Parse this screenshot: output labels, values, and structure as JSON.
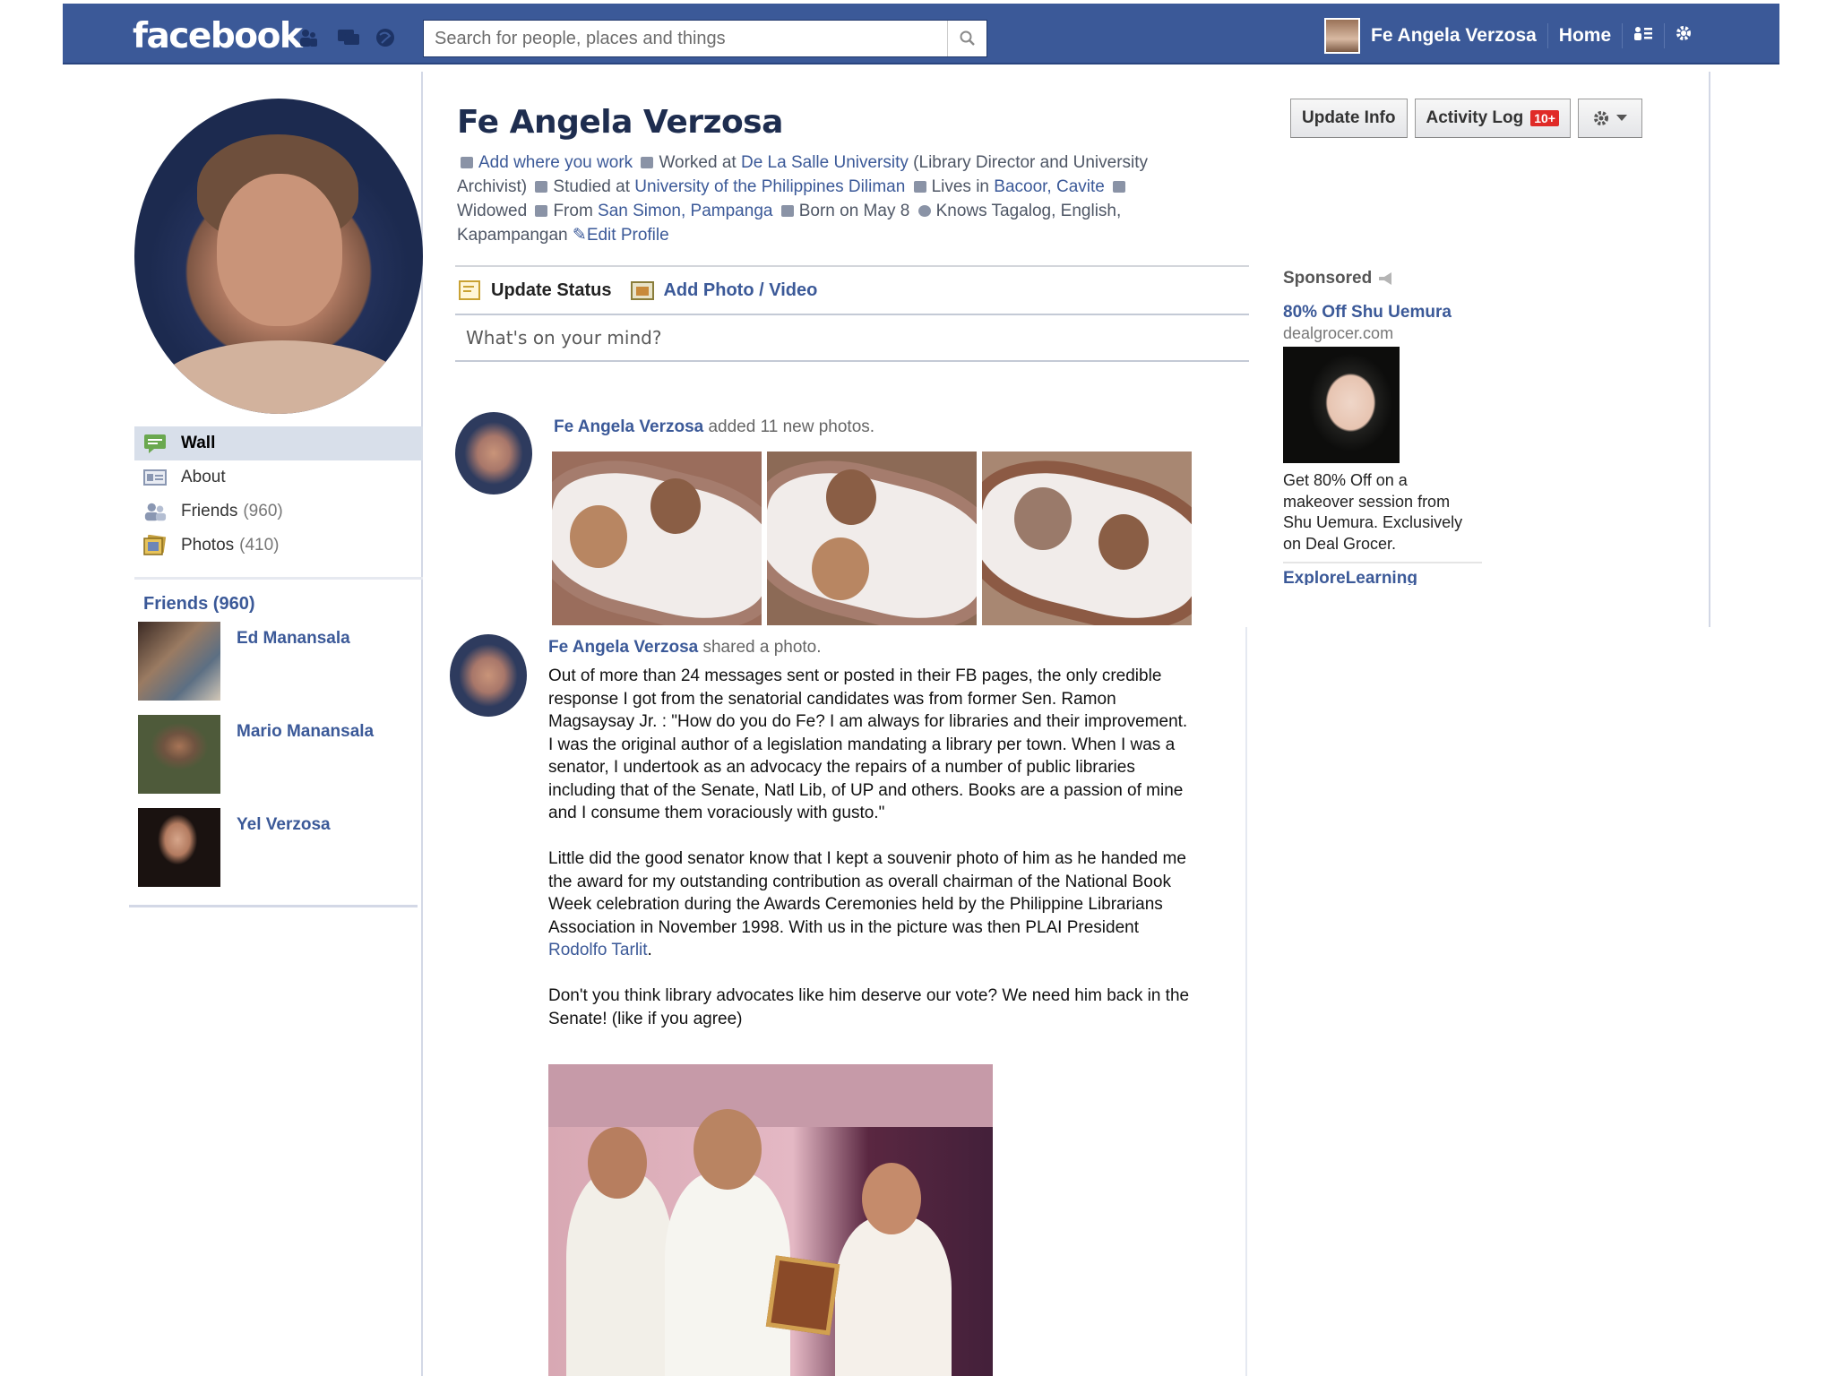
{
  "topbar": {
    "logo": "facebook",
    "search_placeholder": "Search for people, places and things",
    "user_name": "Fe Angela Verzosa",
    "home": "Home"
  },
  "profile": {
    "name": "Fe Angela Verzosa",
    "about": {
      "add_work": "Add where you work",
      "worked_prefix": "Worked at",
      "worked_at": "De La Salle University",
      "worked_role": "(Library Director and University Archivist)",
      "studied_prefix": "Studied at",
      "studied_at": "University of the Philippines Diliman",
      "lives_prefix": "Lives in",
      "lives_in": "Bacoor, Cavite",
      "relationship": "Widowed",
      "from_prefix": "From",
      "from": "San Simon, Pampanga",
      "born": "Born on May 8",
      "languages": "Knows Tagalog, English, Kapampangan",
      "edit": "Edit Profile"
    }
  },
  "header_buttons": {
    "update_info": "Update Info",
    "activity_log": "Activity Log",
    "activity_badge": "10+"
  },
  "sidenav": {
    "items": [
      {
        "label": "Wall",
        "count": ""
      },
      {
        "label": "About",
        "count": ""
      },
      {
        "label": "Friends",
        "count": "(960)"
      },
      {
        "label": "Photos",
        "count": "(410)"
      }
    ]
  },
  "friends": {
    "title": "Friends (960)",
    "list": [
      {
        "name": "Ed Manansala"
      },
      {
        "name": "Mario Manansala"
      },
      {
        "name": "Yel Verzosa"
      }
    ]
  },
  "composer": {
    "update_status": "Update Status",
    "add_photo": "Add Photo / Video",
    "placeholder": "What's on your mind?"
  },
  "stories": {
    "story1": {
      "actor": "Fe Angela Verzosa",
      "action": "added 11 new photos."
    },
    "story2": {
      "actor": "Fe Angela Verzosa",
      "action": "shared a photo.",
      "body_part1": "Out of more than 24 messages sent or posted in their FB pages, the only credible response I got from the senatorial candidates was from former Sen. Ramon Magsaysay Jr. : \"How do you do Fe? I am always for libraries and their improvement. I was the original author of a legislation mandating a library per town. When I was a senator, I undertook as an advocacy the repairs of a number of public libraries including that of the Senate, Natl Lib, of UP and others. Books are a passion of mine and I consume them voraciously with gusto.\"\n\nLittle did the good senator know that I kept a souvenir photo of him as he handed me the award for my outstanding contribution as overall chairman of the National Book Week celebration during the Awards Ceremonies held by the Philippine Librarians Association in November 1998. With us in the picture was then PLAI President ",
      "body_link": "Rodolfo Tarlit",
      "body_part2": ".\n\nDon't you think library advocates like him deserve our vote? We need him back in the Senate! (like if you agree)"
    }
  },
  "sponsored": {
    "title": "Sponsored",
    "ad1": {
      "title": "80% Off Shu Uemura",
      "domain": "dealgrocer.com",
      "text": "Get 80% Off on a makeover session from Shu Uemura. Exclusively on Deal Grocer."
    },
    "ad2": {
      "title": "ExploreLearning"
    }
  }
}
